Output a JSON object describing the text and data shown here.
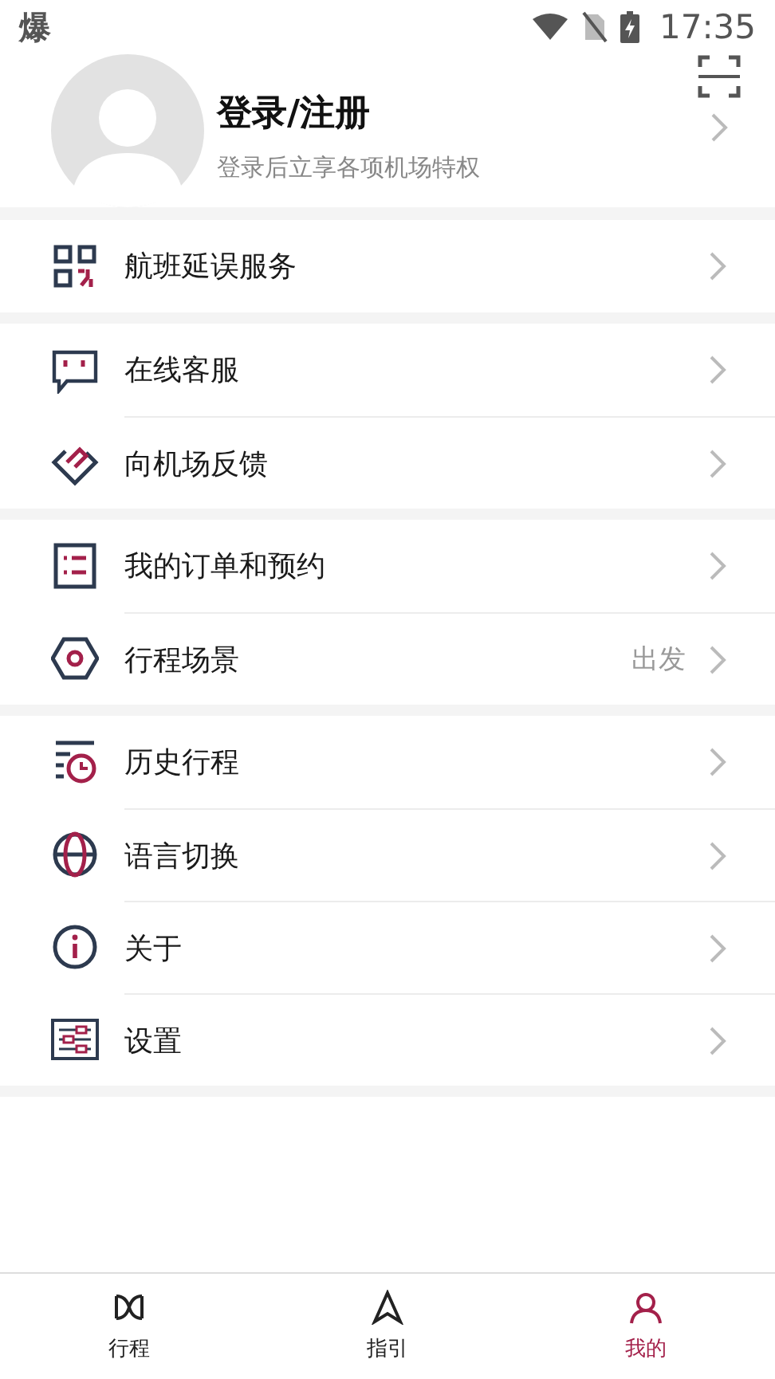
{
  "status_bar": {
    "left_label": "爆",
    "time": "17:35"
  },
  "profile": {
    "title": "登录/注册",
    "subtitle": "登录后立享各项机场特权"
  },
  "groups": [
    [
      {
        "label": "航班延误服务"
      }
    ],
    [
      {
        "label": "在线客服"
      },
      {
        "label": "向机场反馈"
      }
    ],
    [
      {
        "label": "我的订单和预约"
      },
      {
        "label": "行程场景",
        "value": "出发"
      }
    ],
    [
      {
        "label": "历史行程"
      },
      {
        "label": "语言切换"
      },
      {
        "label": "关于"
      },
      {
        "label": "设置"
      }
    ]
  ],
  "tab_bar": [
    {
      "label": "行程",
      "selected": false
    },
    {
      "label": "指引",
      "selected": false
    },
    {
      "label": "我的",
      "selected": true
    }
  ]
}
